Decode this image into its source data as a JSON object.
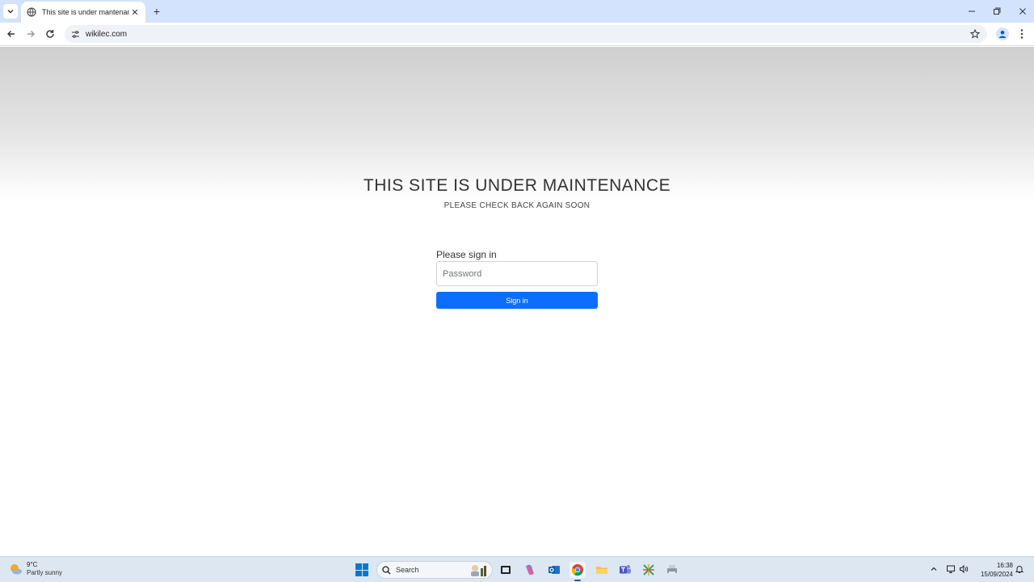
{
  "browser": {
    "tab_title": "This site is under mantenance",
    "url": "wikilec.com"
  },
  "page": {
    "headline": "THIS SITE IS UNDER MAINTENANCE",
    "subline": "PLEASE CHECK BACK AGAIN SOON",
    "signin_label": "Please sign in",
    "password_placeholder": "Password",
    "signin_button": "Sign in"
  },
  "taskbar": {
    "weather_temp": "9°C",
    "weather_condition": "Partly sunny",
    "search_label": "Search",
    "time": "16:38",
    "date": "15/09/2024"
  },
  "colors": {
    "accent": "#0d6efd",
    "tab_strip": "#d3e3fd",
    "taskbar": "#dde7f2"
  }
}
